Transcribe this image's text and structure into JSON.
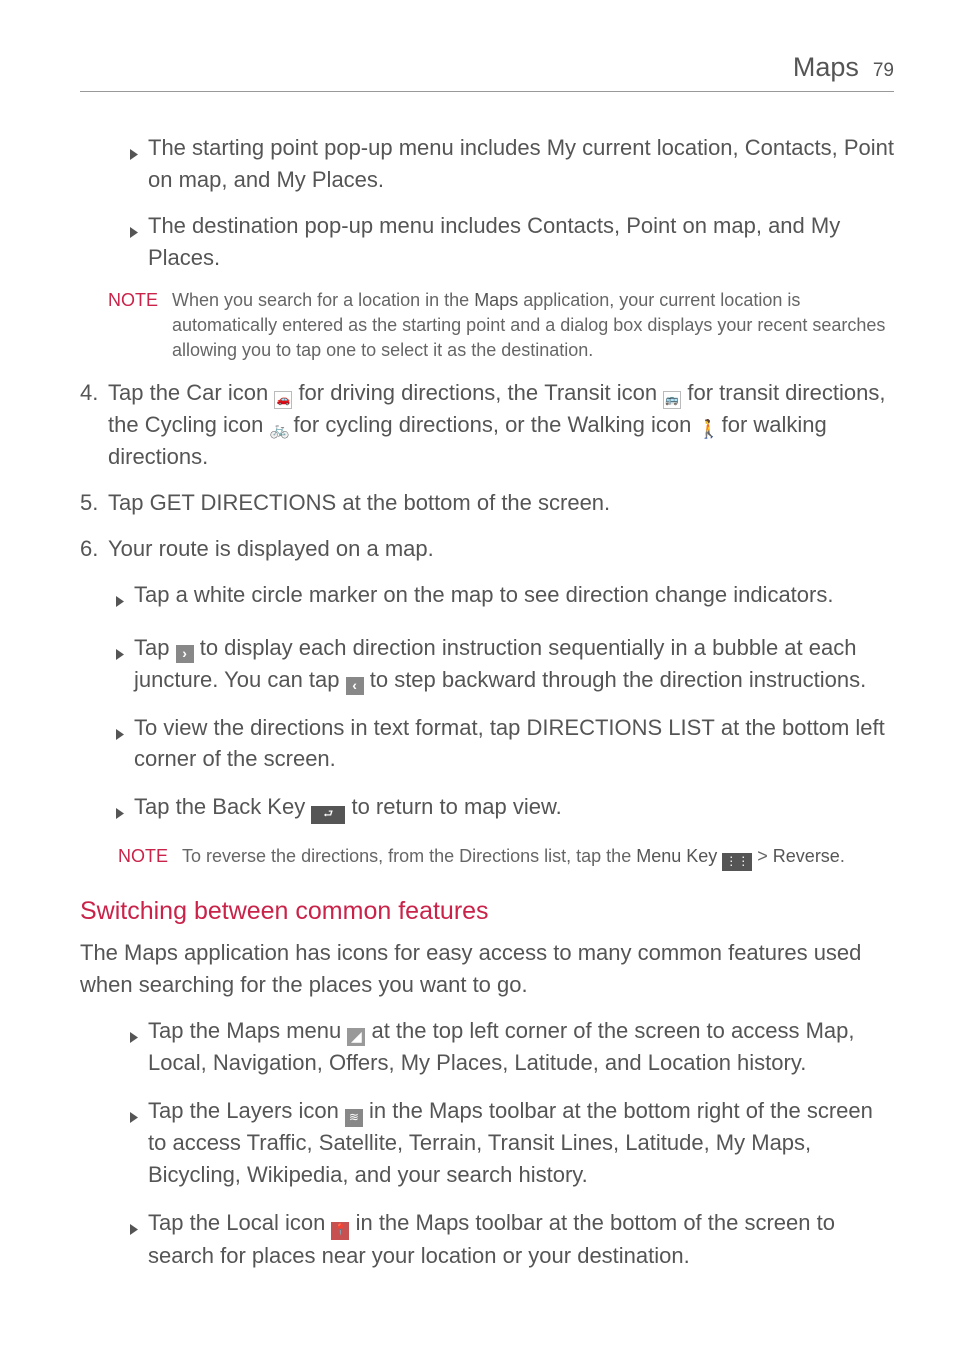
{
  "header": {
    "title": "Maps",
    "page": "79"
  },
  "startBullet": {
    "pre": "The starting point pop-up menu includes ",
    "b1": "My current location",
    "c1": ", ",
    "b2": "Contacts",
    "c2": ", ",
    "b3": "Point on map",
    "c3": ", and ",
    "b4": "My Places",
    "post": "."
  },
  "destBullet": {
    "pre": "The destination pop-up menu includes ",
    "b1": "Contacts",
    "c1": ", ",
    "b2": "Point on map",
    "c2": ", and ",
    "b3": "My Places",
    "post": "."
  },
  "note1": {
    "label": "NOTE",
    "s1": "When you search for a location in the ",
    "b1": "Maps",
    "s2": " application, your current location is automatically entered as the starting point and a dialog box displays your recent searches allowing you to tap one to select it as the destination."
  },
  "step4": {
    "num": "4.",
    "s1": "Tap the ",
    "b1": "Car",
    "s2": " icon ",
    "s3": " for driving directions, the ",
    "b2": "Transit",
    "s4": " icon ",
    "s5": " for transit directions, the ",
    "b3": "Cycling",
    "s6": " icon ",
    "s7": " for cycling directions, or the ",
    "b4": "Walking",
    "s8": " icon ",
    "s9": " for walking directions."
  },
  "step5": {
    "num": "5.",
    "s1": "Tap ",
    "b1": "GET DIRECTIONS",
    "s2": " at the bottom of the screen."
  },
  "step6": {
    "num": "6.",
    "text": "Your route is displayed on a map."
  },
  "sub61": "Tap a white circle marker on the map to see direction change indicators.",
  "sub62": {
    "s1": "Tap ",
    "s2": " to display each direction instruction sequentially in a bubble at each juncture. You can tap ",
    "s3": " to step backward through the direction instructions."
  },
  "sub63": {
    "s1": "To view the directions in text format, tap ",
    "b1": "DIRECTIONS LIST",
    "s2": " at the bottom left corner of the screen."
  },
  "sub64": {
    "s1": "Tap the ",
    "b1": "Back Key",
    "s2": " ",
    "s3": " to return to map view."
  },
  "note2": {
    "label": "NOTE",
    "s1": "To reverse the directions, from the Directions list, tap the ",
    "b1": "Menu Key",
    "s2": " ",
    "s3": " > ",
    "b2": "Reverse",
    "s4": "."
  },
  "sectionHeading": "Switching between common features",
  "sectionIntro": {
    "s1": "The ",
    "b1": "Maps",
    "s2": " application has icons for easy access to many common features used when searching for the places you want to go."
  },
  "f1": {
    "s1": "Tap the ",
    "b1": "Maps menu",
    "s2": " ",
    "s3": " at the top left corner of the screen to access Map, Local, Navigation, Offers, My Places, Latitude, and Location history."
  },
  "f2": {
    "s1": "Tap the ",
    "b1": "Layers",
    "s2": " icon ",
    "s3": " in the Maps toolbar at the bottom right of the screen to access Traffic, Satellite, Terrain, Transit Lines, Latitude, My Maps, Bicycling, Wikipedia, and your search history."
  },
  "f3": {
    "s1": "Tap the ",
    "b1": "Local",
    "s2": " icon ",
    "s3": " in the Maps toolbar at the bottom of the screen to search for places near your location or your destination."
  }
}
